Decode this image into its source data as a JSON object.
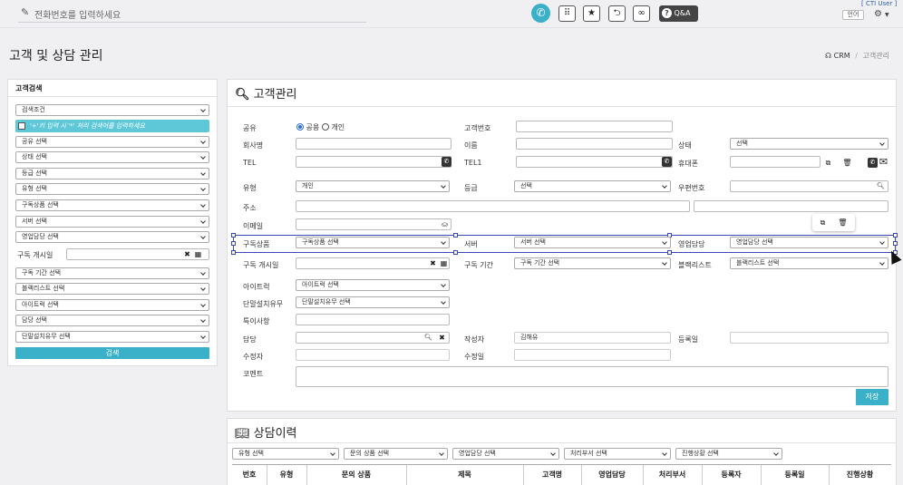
{
  "topbar": {
    "phone_placeholder": "전화번호를 입력하세요",
    "qa_label": "Q&A",
    "cti_user": "[ CTI User ]",
    "lang_label": "언어"
  },
  "page": {
    "title": "고객 및 상담 관리",
    "breadcrumb_root": "CRM",
    "breadcrumb_sep": "/",
    "breadcrumb_current": "고객관리"
  },
  "sidebar": {
    "title": "고객검색",
    "search_cond": "검색조건",
    "hint": "'+'키 입력 시 '*' 처리 검색어를 입력하세요",
    "selects_a": [
      "공유 선택",
      "상태 선택",
      "등급 선택",
      "유형 선택",
      "구독상품 선택",
      "서버 선택",
      "영업담당 선택"
    ],
    "start_label": "구독 개시일",
    "selects_b": [
      "구독 기간 선택",
      "블랙리스트 선택",
      "아이트럭 선택",
      "담당 선택",
      "단말설치유무 선택"
    ],
    "search_button": "검색"
  },
  "customer": {
    "title": "고객관리",
    "share_label": "공유",
    "radio_public": "공용",
    "radio_private": "개인",
    "customer_no_label": "고객번호",
    "company_label": "회사명",
    "name_label": "이름",
    "status_label": "상태",
    "status_value": "선택",
    "tel_label": "TEL",
    "tel1_label": "TEL1",
    "mobile_label": "휴대폰",
    "type_label": "유형",
    "type_value": "개인",
    "grade_label": "등급",
    "grade_value": "선택",
    "zip_label": "우편번호",
    "address_label": "주소",
    "email_label": "이메일",
    "product_label": "구독상품",
    "product_value": "구독상품 선택",
    "server_label": "서버",
    "server_value": "서버 선택",
    "sales_label": "영업담당",
    "sales_value": "영업담당 선택",
    "start_label": "구독 개시일",
    "period_label": "구독 기간",
    "period_value": "구독 기간 선택",
    "blacklist_label": "블랙리스트",
    "blacklist_value": "블랙리스트 선택",
    "itruck_label": "아이트럭",
    "itruck_value": "아이트럭 선택",
    "device_label": "단말설치유무",
    "device_value": "단말설치유무 선택",
    "special_label": "특이사항",
    "manager_label": "담당",
    "writer_label": "작성자",
    "writer_value": "김해유",
    "reg_date_label": "등록일",
    "editor_label": "수정자",
    "edit_date_label": "수정일",
    "comment_label": "코멘트",
    "save_button": "저장"
  },
  "history": {
    "title": "상담이력",
    "filters": [
      "유형 선택",
      "문의 상품 선택",
      "영업담당 선택",
      "처리부서 선택",
      "진행상황 선택"
    ],
    "columns": [
      "번호",
      "유형",
      "문의 상품",
      "제목",
      "고객명",
      "영업담당",
      "처리부서",
      "등록자",
      "등록일",
      "진행상황"
    ]
  },
  "colors": {
    "accent": "#3bb0c9",
    "selection": "#3a48b8"
  }
}
